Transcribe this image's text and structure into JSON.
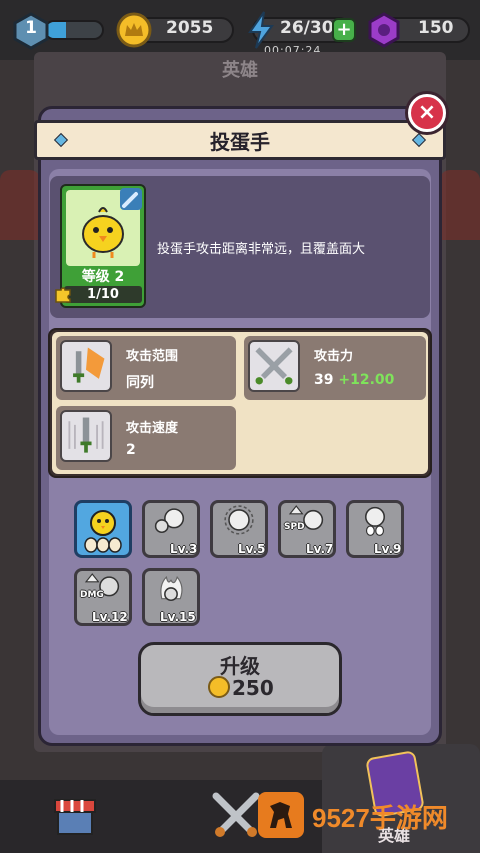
{
  "hud": {
    "player_level": "1",
    "xp_progress": 0.35,
    "gold": "2055",
    "energy": "26/30",
    "energy_timer": "00:07:24",
    "gems": "150"
  },
  "background": {
    "screen_title": "英雄",
    "hero_tab_label": "英雄",
    "watermark_text": "9527手游网"
  },
  "modal": {
    "title": "投蛋手",
    "close_label": "×",
    "hero": {
      "level_label": "等级 2",
      "fragments": "1/10",
      "fragment_progress": 0.1,
      "description": "投蛋手攻击距离非常远，且覆盖面大"
    },
    "stats": [
      {
        "label": "攻击范围",
        "value": "同列",
        "bonus": ""
      },
      {
        "label": "攻击力",
        "value": "39",
        "bonus": "+12.00"
      },
      {
        "label": "攻击速度",
        "value": "2",
        "bonus": ""
      }
    ],
    "skills": [
      {
        "level": "",
        "icon": "egg-chick-icon",
        "active": true
      },
      {
        "level": "Lv.3",
        "icon": "split-chick-icon",
        "active": false
      },
      {
        "level": "Lv.5",
        "icon": "gear-chick-icon",
        "active": false
      },
      {
        "level": "Lv.7",
        "icon": "spd-chick-icon",
        "active": false,
        "tag": "SPD"
      },
      {
        "level": "Lv.9",
        "icon": "multi-egg-icon",
        "active": false
      },
      {
        "level": "Lv.12",
        "icon": "dmg-chick-icon",
        "active": false,
        "tag": "DMG"
      },
      {
        "level": "Lv.15",
        "icon": "fire-chick-icon",
        "active": false
      }
    ],
    "upgrade": {
      "label": "升级",
      "cost": "250"
    }
  },
  "colors": {
    "modal_bg": "#6d6389",
    "ribbon": "#f4e7cf",
    "close": "#d7334a",
    "hero_card": "#3fa037",
    "bonus": "#7fe35b",
    "skill_active": "#52a7e0"
  }
}
